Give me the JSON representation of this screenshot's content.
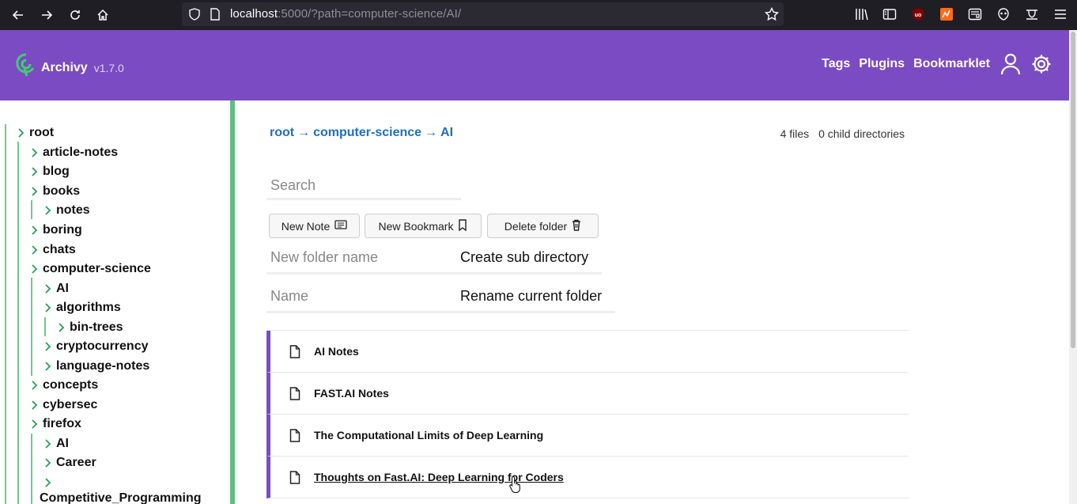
{
  "browser": {
    "url_prefix": "localhost",
    "url_rest": ":5000/?path=computer-science/AI/"
  },
  "header": {
    "app_name": "Archivy",
    "version": "v1.7.0",
    "nav": [
      "Tags",
      "Plugins",
      "Bookmarklet"
    ],
    "colors": {
      "header_bg": "#7b4bc3",
      "logo_green": "#3ecf6f"
    }
  },
  "sidebar": {
    "accent": "#5fbf7e",
    "items": [
      {
        "label": "root"
      },
      {
        "label": "article-notes"
      },
      {
        "label": "blog"
      },
      {
        "label": "books"
      },
      {
        "label": "notes"
      },
      {
        "label": "boring"
      },
      {
        "label": "chats"
      },
      {
        "label": "computer-science"
      },
      {
        "label": "AI"
      },
      {
        "label": "algorithms"
      },
      {
        "label": "bin-trees"
      },
      {
        "label": "cryptocurrency"
      },
      {
        "label": "language-notes"
      },
      {
        "label": "concepts"
      },
      {
        "label": "cybersec"
      },
      {
        "label": "firefox"
      },
      {
        "label": "AI"
      },
      {
        "label": "Career"
      },
      {
        "label": ""
      },
      {
        "label": "Competitive_Programming"
      }
    ]
  },
  "main": {
    "breadcrumb": [
      "root",
      "computer-science",
      "AI"
    ],
    "breadcrumb_sep": "→",
    "stats": {
      "files": "4 files",
      "dirs": "0 child directories"
    },
    "search_placeholder": "Search",
    "buttons": {
      "new_note": "New Note",
      "new_bookmark": "New Bookmark",
      "delete_folder": "Delete folder"
    },
    "create_dir": {
      "placeholder": "New folder name",
      "submit": "Create sub directory"
    },
    "rename": {
      "placeholder": "Name",
      "submit": "Rename current folder"
    },
    "files": [
      {
        "title": "AI Notes"
      },
      {
        "title": "FAST.AI Notes"
      },
      {
        "title": "The Computational Limits of Deep Learning"
      },
      {
        "title": "Thoughts on Fast.AI: Deep Learning for Coders"
      }
    ]
  }
}
